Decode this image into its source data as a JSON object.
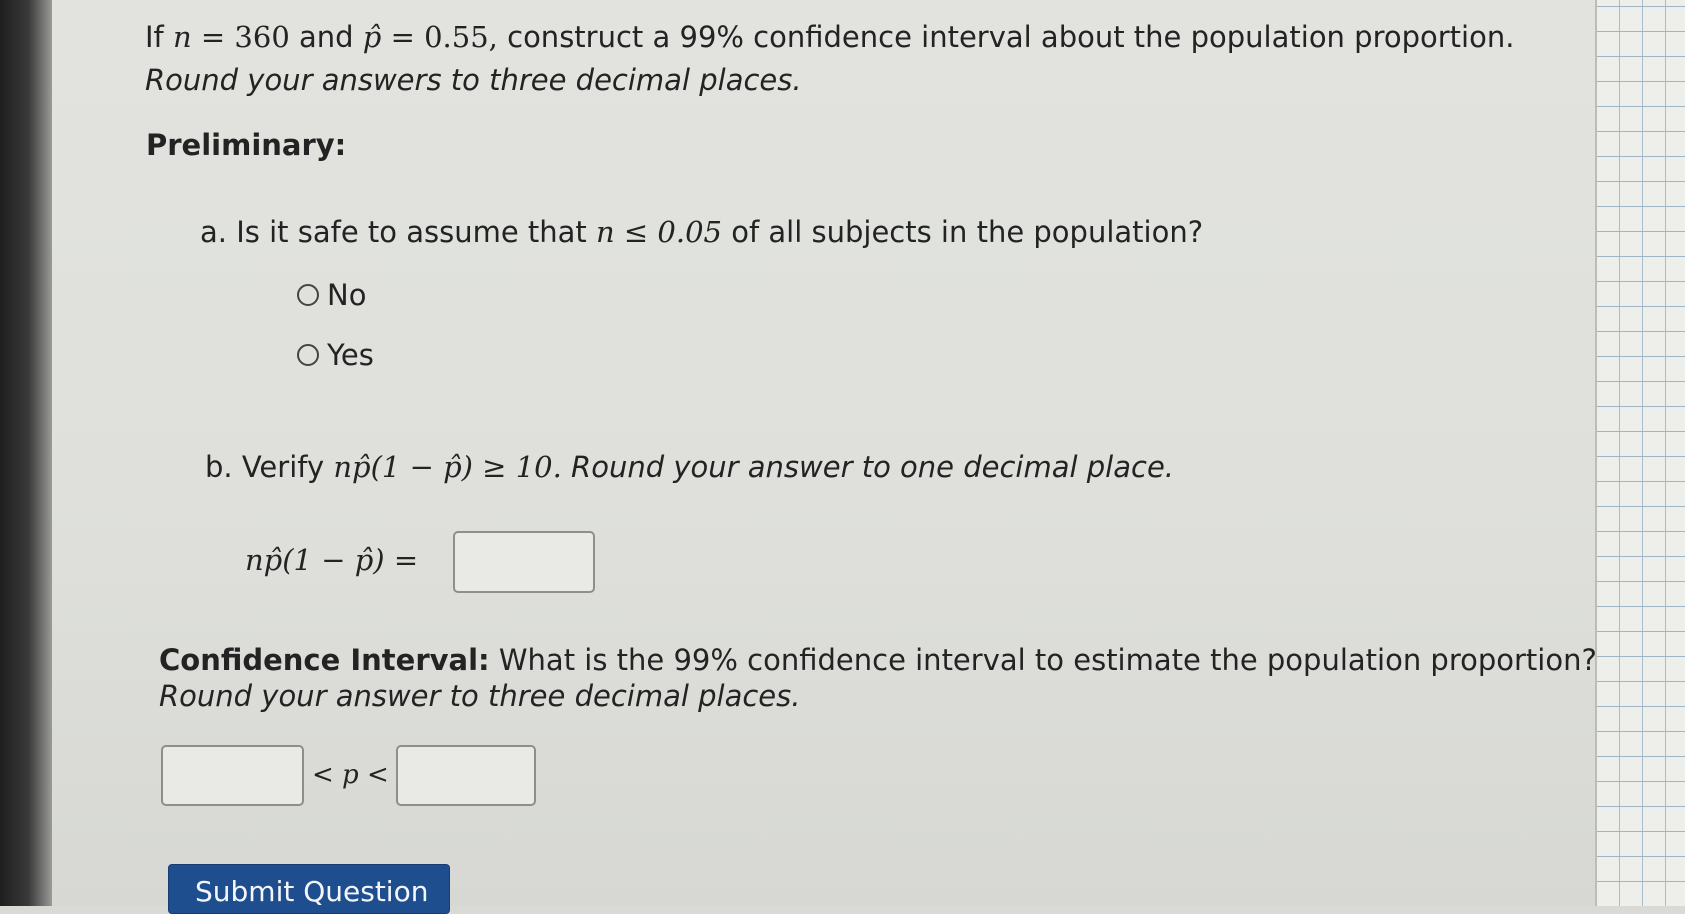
{
  "question": {
    "intro_if": "If",
    "n_sym": "n",
    "eq": "=",
    "n_val": "360",
    "and": "and",
    "phat": "p̂",
    "phat_val": "0.55,",
    "rest": "construct a 99% confidence interval about the population proportion.",
    "line2": "Round your answers to three decimal places."
  },
  "preliminary": {
    "heading": "Preliminary:"
  },
  "part_a": {
    "prefix": "a. Is it safe to assume that",
    "math": "n ≤ 0.05",
    "suffix": "of all subjects in the population?",
    "options": [
      "No",
      "Yes"
    ]
  },
  "part_b": {
    "prefix": "b. Verify",
    "math": "np̂(1 − p̂) ≥ 10.",
    "suffix": "Round your answer to one decimal place.",
    "lhs": "np̂(1 − p̂) =",
    "answer": ""
  },
  "confidence_interval": {
    "heading": "Confidence Interval:",
    "text": "What is the 99% confidence interval to estimate the population proportion?",
    "line2": "Round your answer to three decimal places.",
    "lower": "",
    "middle": "< p <",
    "upper": ""
  },
  "submit": {
    "label": "Submit Question"
  }
}
